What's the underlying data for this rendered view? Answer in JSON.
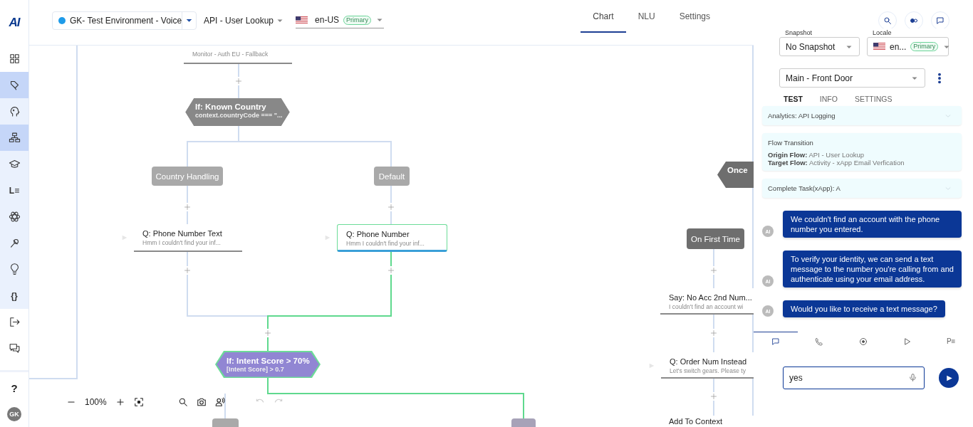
{
  "sidebar": {
    "logo": "AI",
    "groups": [
      {
        "tinted": false,
        "items": [
          {
            "kind": "grid",
            "selected": false
          }
        ]
      },
      {
        "tinted": true,
        "items": [
          {
            "kind": "tag",
            "selected": true
          },
          {
            "kind": "head",
            "selected": false
          },
          {
            "kind": "flow",
            "selected": true
          },
          {
            "kind": "cap",
            "selected": false
          },
          {
            "kind": "glyph",
            "glyph": "L≡",
            "selected": false
          },
          {
            "kind": "atom",
            "selected": false
          },
          {
            "kind": "pin",
            "selected": false
          },
          {
            "kind": "bulb",
            "selected": false
          },
          {
            "kind": "glyph",
            "glyph": "{}",
            "selected": false
          }
        ]
      },
      {
        "tinted": false,
        "items": [
          {
            "kind": "logout",
            "selected": false
          },
          {
            "kind": "chat",
            "selected": false
          }
        ]
      }
    ],
    "help": "?",
    "avatar": "GK"
  },
  "header": {
    "environment": {
      "name": "GK- Test Environment - Voice",
      "color": "#1e9be9"
    },
    "flow": "API - User Lookup",
    "locale": {
      "code": "en-US",
      "badge": "Primary"
    },
    "tabs": [
      {
        "label": "Chart",
        "selected": true
      },
      {
        "label": "NLU",
        "selected": false
      },
      {
        "label": "Settings",
        "selected": false
      }
    ],
    "actions": [
      {
        "kind": "search"
      },
      {
        "kind": "toggle"
      },
      {
        "kind": "chat"
      }
    ]
  },
  "canvas": {
    "nodes": [
      {
        "kind": "step",
        "subtitle": "Monitor - Auth EU - Fallback"
      },
      {
        "kind": "condition",
        "title": "If: Known Country",
        "subtitle": "context.countryCode === \"...",
        "color": "#888888",
        "on_path": false
      },
      {
        "kind": "branch",
        "label": "Country Handling",
        "color": "#a9a9a9"
      },
      {
        "kind": "branch",
        "label": "Default",
        "color": "#a9a9a9"
      },
      {
        "kind": "step",
        "title": "Q: Phone Number Text",
        "subtitle": "Hmm I couldn't find your inf...",
        "entry": true,
        "on_path": false,
        "selected": false
      },
      {
        "kind": "step",
        "title": "Q: Phone Number",
        "subtitle": "Hmm I couldn't find your inf...",
        "entry": true,
        "on_path": true,
        "selected": true
      },
      {
        "kind": "condition",
        "title": "If: Intent Score > 70%",
        "subtitle": "[Intent Score] > 0.7",
        "color": "#9186d3",
        "on_path": true
      },
      {
        "kind": "branch",
        "color": "#a9a9a9"
      },
      {
        "kind": "branch",
        "color": "#a7a2b8"
      },
      {
        "kind": "once",
        "label": "Once",
        "color": "#6e6e6e"
      },
      {
        "kind": "branch",
        "label": "On First Time",
        "color": "#6e6e6e"
      },
      {
        "kind": "step",
        "title": "Say: No Acc 2nd Num...",
        "subtitle": "I couldn't find an account wi",
        "entry": false,
        "on_path": false,
        "selected": false
      },
      {
        "kind": "step",
        "title": "Q: Order Num Instead",
        "subtitle": "Let's switch gears. Please ty",
        "entry": true,
        "on_path": false,
        "selected": false
      },
      {
        "kind": "step",
        "title": "Add To Context"
      }
    ],
    "toolbar": {
      "zoom": "100%",
      "undo_disabled": true,
      "redo_disabled": true
    }
  },
  "panel": {
    "snapshot": {
      "label": "Snapshot",
      "value": "No Snapshot"
    },
    "locale": {
      "label": "Locale",
      "value": "en...",
      "badge": "Primary"
    },
    "flow": "Main - Front Door",
    "tabs": [
      {
        "label": "TEST",
        "selected": true
      },
      {
        "label": "INFO",
        "selected": false
      },
      {
        "label": "SETTINGS",
        "selected": false
      }
    ],
    "events": [
      {
        "kind": "collapsed",
        "title": "Analytics: API Logging"
      },
      {
        "kind": "detail",
        "title": "Flow Transition",
        "lines": [
          "**Origin Flow:** API - User Lookup",
          "**Target Flow:** Activity - xApp Email Verfication"
        ]
      },
      {
        "kind": "collapsed",
        "title": "Complete Task(xApp): A"
      }
    ],
    "messages": [
      {
        "avatar": "AI",
        "text": "We couldn't find an account with the phone number you entered."
      },
      {
        "avatar": "AI",
        "text": "To verify your identity, we can send a text message to the number you're calling from and authenticate using your email address."
      },
      {
        "avatar": "AI",
        "text": "Would you like to receive a text message?"
      }
    ],
    "modes": [
      {
        "kind": "chat",
        "selected": true
      },
      {
        "kind": "phone",
        "selected": false
      },
      {
        "kind": "record",
        "selected": false
      },
      {
        "kind": "play",
        "selected": false
      },
      {
        "kind": "glyph",
        "glyph": "P≡",
        "selected": false
      }
    ],
    "input": {
      "value": "yes"
    }
  }
}
